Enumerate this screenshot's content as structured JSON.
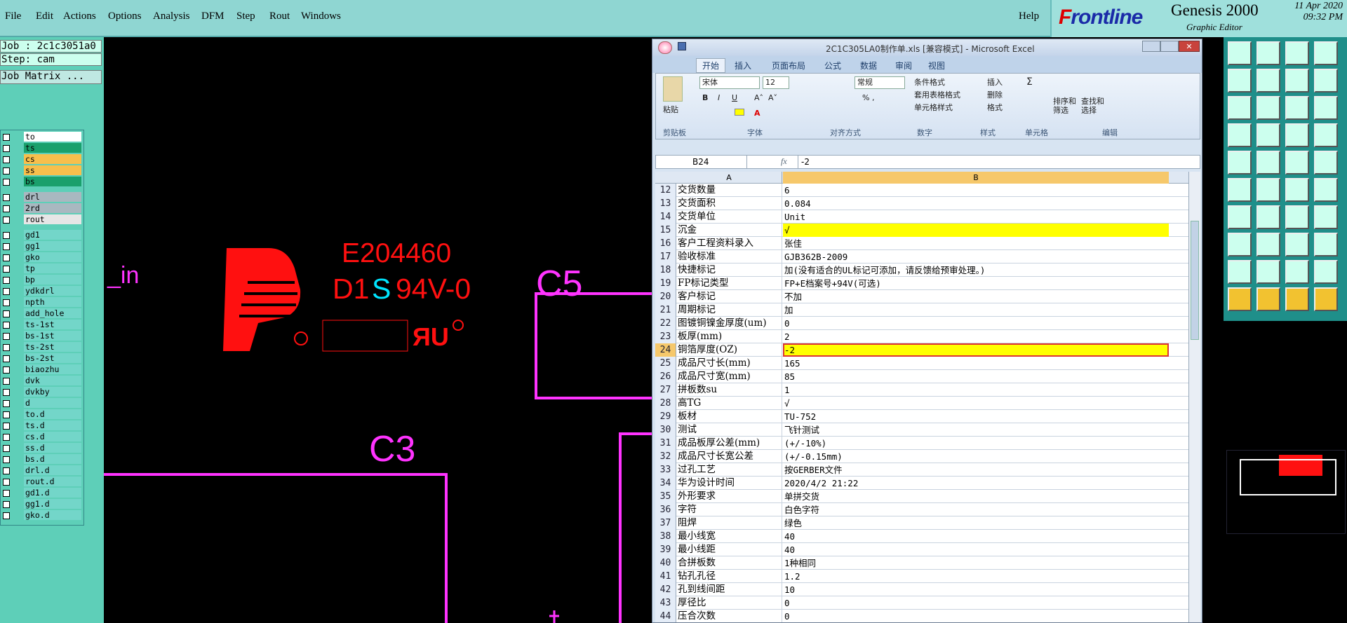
{
  "menu": [
    "File",
    "Edit",
    "Actions",
    "Options",
    "Analysis",
    "DFM",
    "Step",
    "Rout",
    "Windows"
  ],
  "help": "Help",
  "brand": {
    "logo_prefix": "F",
    "logo_rest": "rontline",
    "product": "Genesis 2000",
    "subtitle": "Graphic Editor",
    "date": "11 Apr 2020",
    "time": "09:32 PM"
  },
  "left": {
    "job": "Job : 2c1c3051a0",
    "step": "Step: cam",
    "matrix_button": "Job Matrix ..."
  },
  "layers": [
    {
      "name": "to",
      "color": "#ffffff"
    },
    {
      "name": "ts",
      "color": "#1aa06c"
    },
    {
      "name": "cs",
      "color": "#f7bf4c"
    },
    {
      "name": "ss",
      "color": "#f7bf4c"
    },
    {
      "name": "bs",
      "color": "#1aa06c"
    },
    {
      "name": "drl",
      "color": "#a9b8c0"
    },
    {
      "name": "2rd",
      "color": "#a9b8c0"
    },
    {
      "name": "rout",
      "color": "#e6e6e6"
    },
    {
      "name": "gd1",
      "color": "#73d6c9"
    },
    {
      "name": "gg1",
      "color": "#73d6c9"
    },
    {
      "name": "gko",
      "color": "#73d6c9"
    },
    {
      "name": "tp",
      "color": "#73d6c9"
    },
    {
      "name": "bp",
      "color": "#73d6c9"
    },
    {
      "name": "ydkdrl",
      "color": "#73d6c9"
    },
    {
      "name": "npth",
      "color": "#73d6c9"
    },
    {
      "name": "add_hole",
      "color": "#73d6c9"
    },
    {
      "name": "ts-1st",
      "color": "#73d6c9"
    },
    {
      "name": "bs-1st",
      "color": "#73d6c9"
    },
    {
      "name": "ts-2st",
      "color": "#73d6c9"
    },
    {
      "name": "bs-2st",
      "color": "#73d6c9"
    },
    {
      "name": "biaozhu",
      "color": "#73d6c9"
    },
    {
      "name": "dvk",
      "color": "#73d6c9"
    },
    {
      "name": "dvkby",
      "color": "#73d6c9"
    },
    {
      "name": "d",
      "color": "#73d6c9"
    },
    {
      "name": "to.d",
      "color": "#73d6c9"
    },
    {
      "name": "ts.d",
      "color": "#73d6c9"
    },
    {
      "name": "cs.d",
      "color": "#73d6c9"
    },
    {
      "name": "ss.d",
      "color": "#73d6c9"
    },
    {
      "name": "bs.d",
      "color": "#73d6c9"
    },
    {
      "name": "drl.d",
      "color": "#73d6c9"
    },
    {
      "name": "rout.d",
      "color": "#73d6c9"
    },
    {
      "name": "gd1.d",
      "color": "#73d6c9"
    },
    {
      "name": "gg1.d",
      "color": "#73d6c9"
    },
    {
      "name": "gko.d",
      "color": "#73d6c9"
    }
  ],
  "cad": {
    "label_in": "_in",
    "ul_number": "E204460",
    "d1": "D1",
    "s": "S",
    "rating": "94V-0",
    "c5": "C5",
    "c3": "C3"
  },
  "excel": {
    "title": "2C1C305LA0制作单.xls [兼容模式] - Microsoft Excel",
    "tabs": [
      "开始",
      "插入",
      "页面布局",
      "公式",
      "数据",
      "审阅",
      "视图"
    ],
    "groups": [
      "剪贴板",
      "字体",
      "对齐方式",
      "数字",
      "样式",
      "单元格",
      "编辑"
    ],
    "paste": "粘贴",
    "font": "宋体",
    "font_size": "12",
    "number_format": "常规",
    "styles": [
      "条件格式",
      "套用表格格式",
      "单元格样式"
    ],
    "cells": [
      "插入",
      "删除",
      "格式"
    ],
    "edit": [
      "排序和筛选",
      "查找和选择"
    ],
    "name_box": "B24",
    "formula": "-2",
    "col_a": "A",
    "col_b": "B",
    "rows": [
      [
        "12",
        "交货数量",
        "6"
      ],
      [
        "13",
        "交货面积",
        "0.084"
      ],
      [
        "14",
        "交货单位",
        "Unit"
      ],
      [
        "15",
        "沉金",
        "√"
      ],
      [
        "16",
        "客户工程资料录入",
        "张佳"
      ],
      [
        "17",
        "验收标准",
        "GJB362B-2009"
      ],
      [
        "18",
        "快捷标记",
        "加(没有适合的UL标记可添加，请反馈给预审处理。)"
      ],
      [
        "19",
        "FP标记类型",
        "FP+E档案号+94V(可选)"
      ],
      [
        "20",
        "客户标记",
        "不加"
      ],
      [
        "21",
        "周期标记",
        "加"
      ],
      [
        "22",
        "图镀铜镍金厚度(um)",
        "0"
      ],
      [
        "23",
        "板厚(mm)",
        "2"
      ],
      [
        "24",
        "铜箔厚度(OZ)",
        "-2"
      ],
      [
        "25",
        "成品尺寸长(mm)",
        "165"
      ],
      [
        "26",
        "成品尺寸宽(mm)",
        "85"
      ],
      [
        "27",
        "拼板数su",
        "1"
      ],
      [
        "28",
        "高TG",
        "√"
      ],
      [
        "29",
        "板材",
        "TU-752"
      ],
      [
        "30",
        "测试",
        "飞针测试"
      ],
      [
        "31",
        "成品板厚公差(mm)",
        "(+/-10%)"
      ],
      [
        "32",
        "成品尺寸长宽公差",
        "(+/-0.15mm)"
      ],
      [
        "33",
        "过孔工艺",
        "按GERBER文件"
      ],
      [
        "34",
        "华为设计时间",
        "2020/4/2 21:22"
      ],
      [
        "35",
        "外形要求",
        "单拼交货"
      ],
      [
        "36",
        "字符",
        "白色字符"
      ],
      [
        "37",
        "阻焊",
        "绿色"
      ],
      [
        "38",
        "最小线宽",
        "40"
      ],
      [
        "39",
        "最小线距",
        "40"
      ],
      [
        "40",
        "合拼板数",
        "1种相同"
      ],
      [
        "41",
        "钻孔孔径",
        "1.2"
      ],
      [
        "42",
        "孔到线间距",
        "10"
      ],
      [
        "43",
        "厚径比",
        "0"
      ],
      [
        "44",
        "压合次数",
        "0"
      ]
    ]
  },
  "colors": {
    "accent_yellow": "#ffff00",
    "magenta": "#ff33ff",
    "red": "#ff1010",
    "cyan": "#00e5ff"
  }
}
